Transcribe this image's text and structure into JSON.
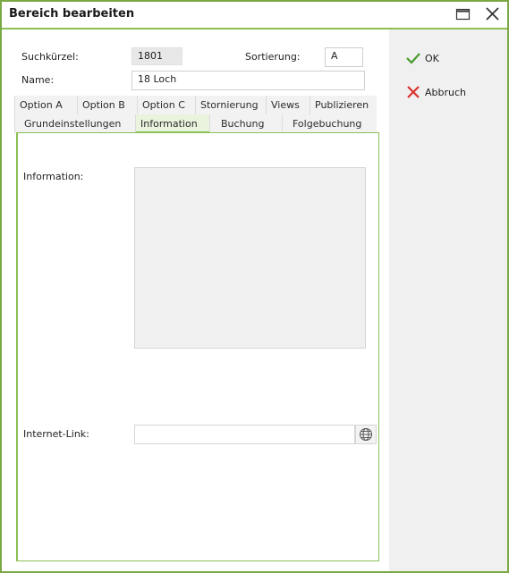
{
  "window": {
    "title": "Bereich bearbeiten"
  },
  "form": {
    "suchkuerzel_label": "Suchkürzel:",
    "suchkuerzel_value": "1801",
    "sortierung_label": "Sortierung:",
    "sortierung_value": "A",
    "name_label": "Name:",
    "name_value": "18 Loch"
  },
  "tabs_row1": [
    "Option A",
    "Option B",
    "Option C",
    "Stornierung",
    "Views",
    "Publizieren"
  ],
  "tabs_row2": [
    "Grundeinstellungen",
    "Information",
    "Buchung",
    "Folgebuchung"
  ],
  "active_tab": "Information",
  "panel": {
    "information_label": "Information:",
    "information_value": "",
    "internet_link_label": "Internet-Link:",
    "internet_link_value": ""
  },
  "actions": {
    "ok_label": "OK",
    "cancel_label": "Abbruch"
  },
  "colors": {
    "accent": "#8cbf55",
    "ok_green": "#4a9b2f",
    "cancel_red": "#d9322e"
  }
}
